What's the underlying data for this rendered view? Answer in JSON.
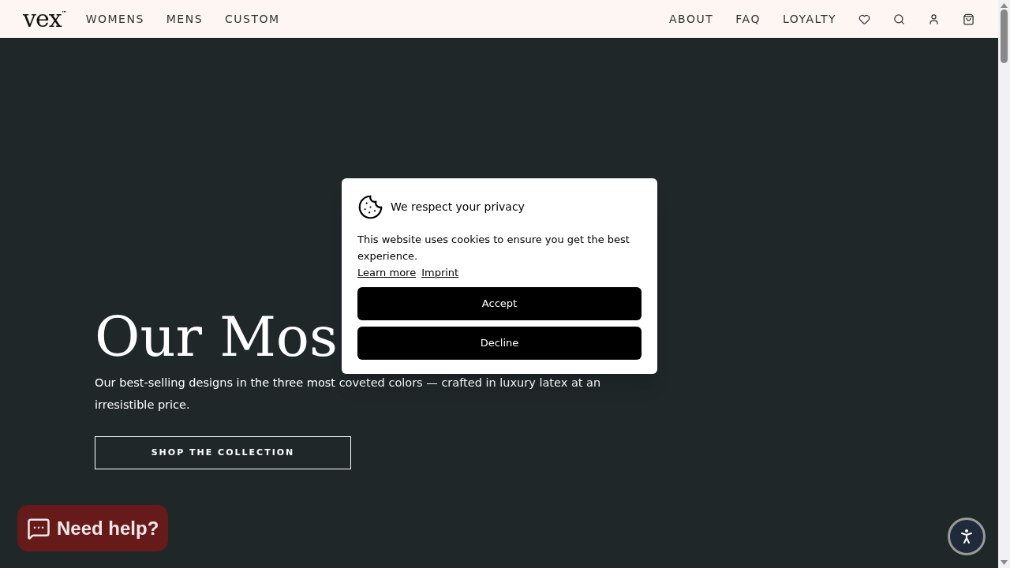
{
  "header": {
    "logo": "vex",
    "logo_mark": "™",
    "nav_left": [
      "WOMENS",
      "MENS",
      "CUSTOM"
    ],
    "nav_right": [
      "ABOUT",
      "FAQ",
      "LOYALTY"
    ]
  },
  "hero": {
    "heading": "Our Mos",
    "subtitle": "Our best-selling designs in the three most coveted colors — crafted in luxury latex at an irresistible price.",
    "button": "SHOP THE COLLECTION"
  },
  "cookie_dialog": {
    "title": "We respect your privacy",
    "text": "This website uses cookies to ensure you get the best experience.",
    "links": [
      "Learn more",
      "Imprint"
    ],
    "buttons": [
      "Accept",
      "Decline"
    ]
  },
  "chat_button": {
    "label": "Need help?"
  }
}
